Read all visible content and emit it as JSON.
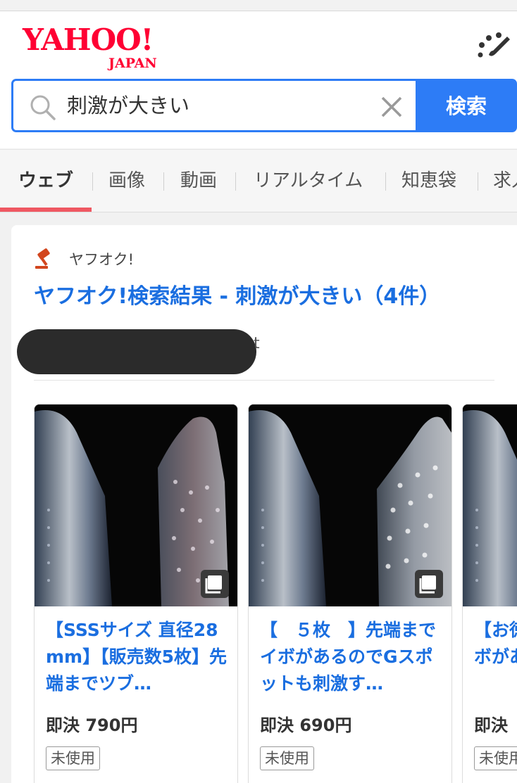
{
  "header": {
    "logo_main": "YAHOO!",
    "logo_sub": "JAPAN"
  },
  "search": {
    "query": "刺激が大きい",
    "button_label": "検索"
  },
  "tabs": [
    "ウェブ",
    "画像",
    "動画",
    "リアルタイム",
    "知恵袋",
    "求人"
  ],
  "active_tab": "ウェブ",
  "result": {
    "source_label": "ヤフオク!",
    "title": "ヤフオク!検索結果 - 刺激が大きい（4件）",
    "redacted_tail": "t"
  },
  "items": [
    {
      "title": "【SSSサイズ 直径28 mm】【販売数5枚】先端までツブ…",
      "price": "即決 790円",
      "badge": "未使用"
    },
    {
      "title": "【　５枚　】先端までイボがあるのでGスポットも刺激す…",
      "price": "即決 690円",
      "badge": "未使用"
    },
    {
      "title": "【お徳用】先端までイボがあるのでGスポ…",
      "price": "即決",
      "badge": "未使用"
    }
  ],
  "colors": {
    "brand_red": "#ff0033",
    "accent_blue": "#2d7cf6",
    "link_blue": "#1a6ee0",
    "tab_underline": "#ef5862"
  }
}
